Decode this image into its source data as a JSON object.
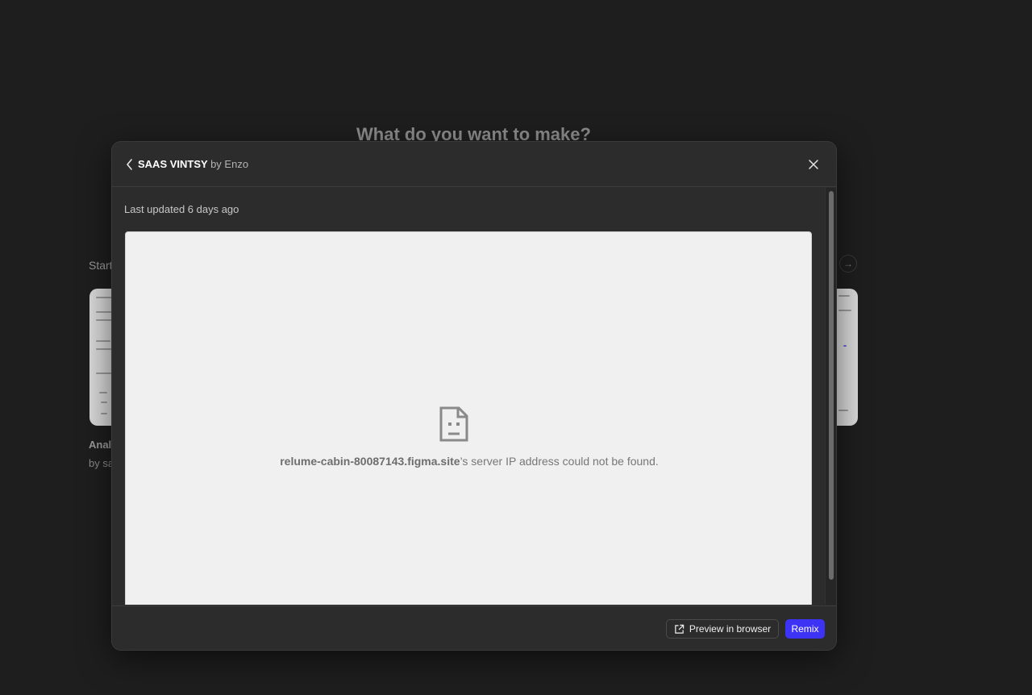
{
  "background": {
    "title": "What do you want to make?",
    "section_label": "Start",
    "card_title": "Anal",
    "card_author": "by sa",
    "next_icon": "arrow-right-icon"
  },
  "modal": {
    "title": "SAAS VINTSY",
    "author": "by Enzo",
    "back_icon": "chevron-left-icon",
    "close_icon": "close-icon",
    "last_updated": "Last updated 6 days ago",
    "preview": {
      "error_icon": "sad-document-icon",
      "error_host": "relume-cabin-80087143.figma.site",
      "error_message": "’s server IP address could not be found."
    },
    "footer": {
      "preview_button": "Preview in browser",
      "preview_icon": "external-link-icon",
      "remix_button": "Remix"
    }
  },
  "colors": {
    "accent": "#3d33f5",
    "modal_bg": "#2c2c2c",
    "page_bg": "#1e1e1e",
    "preview_bg": "#f0f0f0"
  }
}
